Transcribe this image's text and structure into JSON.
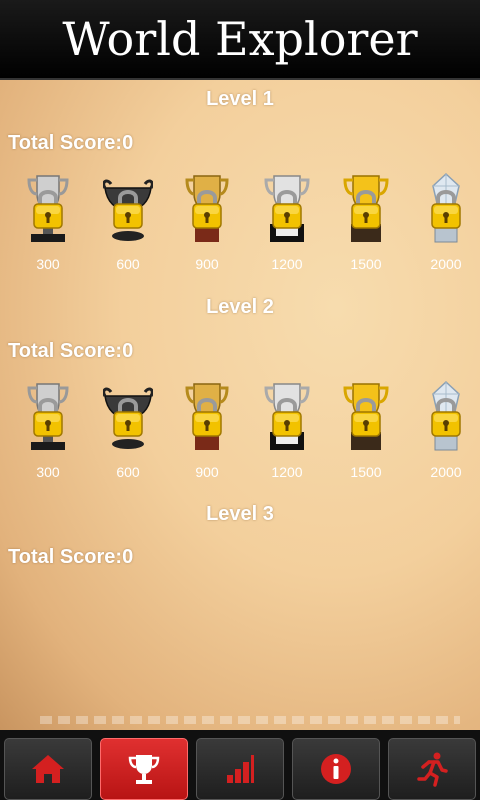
{
  "header": {
    "title": "World Explorer"
  },
  "levels": [
    {
      "title": "Level 1",
      "score_text": "Total Score:0",
      "trophies": [
        {
          "label": "300",
          "type": "silver-cup"
        },
        {
          "label": "600",
          "type": "bronze-bowl"
        },
        {
          "label": "900",
          "type": "gold-cup-wood"
        },
        {
          "label": "1200",
          "type": "silver-cup-plate"
        },
        {
          "label": "1500",
          "type": "gold-cup"
        },
        {
          "label": "2000",
          "type": "crystal-trophy"
        }
      ]
    },
    {
      "title": "Level 2",
      "score_text": "Total Score:0",
      "trophies": [
        {
          "label": "300",
          "type": "silver-cup"
        },
        {
          "label": "600",
          "type": "bronze-bowl"
        },
        {
          "label": "900",
          "type": "gold-cup-wood"
        },
        {
          "label": "1200",
          "type": "silver-cup-plate"
        },
        {
          "label": "1500",
          "type": "gold-cup"
        },
        {
          "label": "2000",
          "type": "crystal-trophy"
        }
      ]
    },
    {
      "title": "Level 3",
      "score_text": "Total Score:0",
      "trophies": []
    }
  ],
  "tabs": [
    {
      "icon": "home-icon",
      "active": false
    },
    {
      "icon": "trophy-icon",
      "active": true
    },
    {
      "icon": "bar-chart-icon",
      "active": false
    },
    {
      "icon": "info-icon",
      "active": false
    },
    {
      "icon": "exit-runner-icon",
      "active": false
    }
  ],
  "colors": {
    "accent_red": "#d42020",
    "lock_gold": "#f2c200",
    "text_white": "#ffffff"
  }
}
